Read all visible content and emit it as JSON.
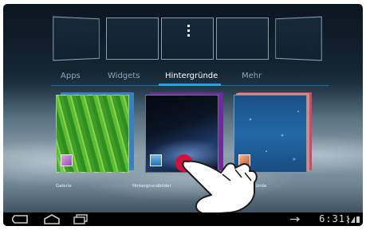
{
  "home_screens": {
    "count": 5,
    "active_index": 2
  },
  "tabs": [
    {
      "label": "Apps",
      "active": false
    },
    {
      "label": "Widgets",
      "active": false
    },
    {
      "label": "Hintergründe",
      "active": true
    },
    {
      "label": "Mehr",
      "active": false
    }
  ],
  "wallpaper_sources": [
    {
      "label": "Galerie",
      "icon": "gallery-icon"
    },
    {
      "label": "Hintergrundbilder",
      "icon": "wallpapers-icon"
    },
    {
      "label": "tergründe",
      "icon": "live-wallpapers-icon"
    }
  ],
  "navigation": {
    "back_icon": "back-icon",
    "home_icon": "home-icon",
    "recent_icon": "recent-apps-icon"
  },
  "status_bar": {
    "time": "6:31",
    "icons": [
      "usb-icon",
      "bluetooth-icon",
      "wifi-icon",
      "battery-icon"
    ]
  },
  "colors": {
    "accent": "#1aa7ec",
    "tab_inactive": "#8fa6b6",
    "navbar": "#000000"
  }
}
